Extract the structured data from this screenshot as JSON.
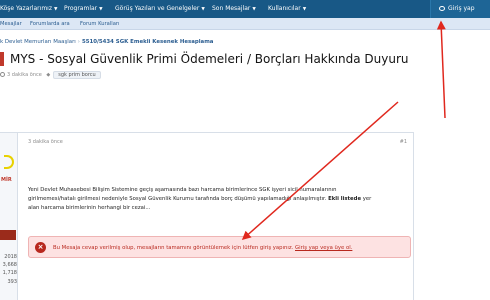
{
  "topnav": {
    "items": [
      {
        "label": "Köşe Yazarlarımız"
      },
      {
        "label": "Programlar"
      },
      {
        "label": "Görüş Yazıları ve Genelgeler"
      },
      {
        "label": "Son Mesajlar"
      },
      {
        "label": "Kullanıcılar"
      }
    ],
    "login_label": "Giriş yap"
  },
  "subnav": {
    "items": [
      {
        "label": "Mesajlar"
      },
      {
        "label": "Forumlarda ara"
      },
      {
        "label": "Forum Kuralları"
      }
    ]
  },
  "breadcrumb": {
    "items": [
      "k Devlet Memurları Maaşları",
      "5510/5434 SGK Emekli Kesenek Hesaplama"
    ]
  },
  "thread": {
    "title": "MYS - Sosyal Güvenlik Primi Ödemeleri / Borçları Hakkında Duyuru",
    "meta_time": "3 dakika önce",
    "tag": "sgk prim borcu"
  },
  "post": {
    "time": "3 dakika önce",
    "number": "#1",
    "user_name": "MİR",
    "stats": [
      "2018",
      "3,668",
      "1,718",
      "393"
    ],
    "body_1": "Yeni Devlet Muhasebesi Bilişim Sistemine geçiş aşamasında bazı harcama birimlerince SGK işyeri sicil numaralarının",
    "body_2_a": "girilmemesi/hatalı girilmesi nedeniyle Sosyal Güvenlik Kurumu tarafında borç düşümü yapılamadığı anlaşılmıştır. ",
    "body_2_b": "Ekli listede",
    "body_2_c": " yer",
    "body_3": "alan harcama birimlerinin herhangi bir cezai..."
  },
  "alert": {
    "text": "Bu Mesaja cevap verilmiş olup, mesajların tamamını görüntülemek için lütfen giriş yapınız. ",
    "link": "Giriş yap veya üye ol."
  },
  "colors": {
    "nav": "#185886",
    "accent_red": "#c0392b",
    "alert_bg": "#fde2e2",
    "annotation_arrow": "#e0281e"
  }
}
